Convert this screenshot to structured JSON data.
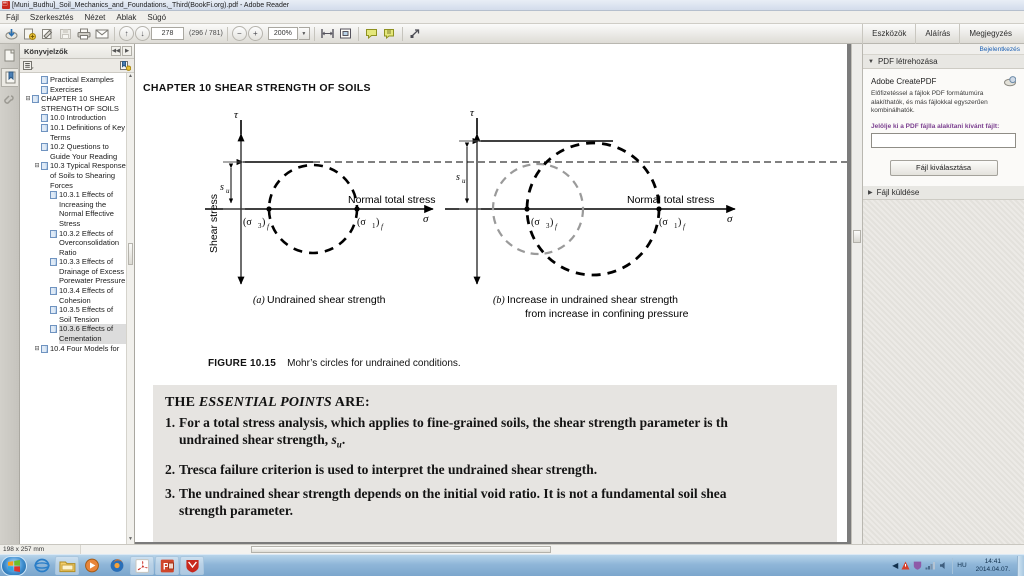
{
  "window": {
    "title": "[Muni_Budhu]_Soil_Mechanics_and_Foundations,_Third(BookFi.org).pdf - Adobe Reader",
    "app_icon": "adobe-reader-icon"
  },
  "menubar": {
    "items": [
      "Fájl",
      "Szerkesztés",
      "Nézet",
      "Ablak",
      "Súgó"
    ]
  },
  "toolbar": {
    "buttons": [
      {
        "name": "save-to-acrobat-com-icon",
        "glyph": "⤓"
      },
      {
        "name": "create-pdf-icon",
        "glyph": "὜E"
      },
      {
        "name": "sign-icon",
        "glyph": "✎"
      },
      {
        "name": "save-icon",
        "glyph": "ὋE"
      },
      {
        "name": "print-icon",
        "glyph": "⎙"
      },
      {
        "name": "email-icon",
        "glyph": "✉"
      }
    ],
    "prev_page_glyph": "↑",
    "next_page_glyph": "↓",
    "page_value": "278",
    "page_count": "(296 / 781)",
    "zoom_out_glyph": "−",
    "zoom_in_glyph": "+",
    "zoom_value": "200%",
    "zoom_dropdown_glyph": "▼",
    "fit_width_glyph": "⌷",
    "fit_page_glyph": "⛶",
    "comment_glyph": "὞9",
    "highlight_glyph": "὘D",
    "fullscreen_glyph": "⤢",
    "right_tabs": [
      "Eszközök",
      "Aláírás",
      "Megjegyzés"
    ]
  },
  "rail": {
    "items": [
      {
        "name": "page-thumbnails-icon",
        "glyph": "❐"
      },
      {
        "name": "bookmarks-icon",
        "glyph": "ὑ6"
      },
      {
        "name": "attachments-icon",
        "glyph": "ὌE"
      }
    ]
  },
  "bookmarks": {
    "panel_title": "Könyvjelzők",
    "nav_prev_glyph": "◀◀",
    "nav_next_glyph": "▶",
    "options_glyph": "≣",
    "newbookmark_glyph": "ὑ6",
    "scroll_up_glyph": "▲",
    "scroll_down_glyph": "▼",
    "items": [
      {
        "label": "Practical Examples",
        "indent": 1,
        "twisty": "",
        "selected": false
      },
      {
        "label": "Exercises",
        "indent": 1,
        "twisty": "",
        "selected": false
      },
      {
        "label": "CHAPTER 10 SHEAR STRENGTH OF SOILS",
        "indent": 0,
        "twisty": "⊟",
        "selected": false
      },
      {
        "label": "10.0 Introduction",
        "indent": 1,
        "twisty": "",
        "selected": false
      },
      {
        "label": "10.1 Definitions of Key Terms",
        "indent": 1,
        "twisty": "",
        "selected": false
      },
      {
        "label": "10.2 Questions to Guide Your Reading",
        "indent": 1,
        "twisty": "",
        "selected": false
      },
      {
        "label": "10.3 Typical Response of Soils to Shearing Forces",
        "indent": 1,
        "twisty": "⊟",
        "selected": false
      },
      {
        "label": "10.3.1 Effects of Increasing the Normal Effective Stress",
        "indent": 2,
        "twisty": "",
        "selected": false
      },
      {
        "label": "10.3.2 Effects of Overconsolidation Ratio",
        "indent": 2,
        "twisty": "",
        "selected": false
      },
      {
        "label": "10.3.3 Effects of Drainage of Excess Porewater Pressure",
        "indent": 2,
        "twisty": "",
        "selected": false
      },
      {
        "label": "10.3.4 Effects of Cohesion",
        "indent": 2,
        "twisty": "",
        "selected": false
      },
      {
        "label": "10.3.5 Effects of Soil Tension",
        "indent": 2,
        "twisty": "",
        "selected": false
      },
      {
        "label": "10.3.6 Effects of Cementation",
        "indent": 2,
        "twisty": "",
        "selected": true
      },
      {
        "label": "10.4 Four Models for",
        "indent": 1,
        "twisty": "⊟",
        "selected": false
      }
    ]
  },
  "document": {
    "chapter_heading": "CHAPTER 10    SHEAR STRENGTH OF SOILS",
    "figure": {
      "panel_a": {
        "tau_label": "τ",
        "sigma_label": "σ",
        "yaxis_label": "Shear stress",
        "xaxis_label": "Normal total stress",
        "su_label": "s",
        "su_sub": "u",
        "sigma3_label": "(σ",
        "sigma3_sub": "3",
        "sigma3_tail": ")",
        "sigma3_f": "f",
        "sigma1_label": "(σ",
        "sigma1_sub": "1",
        "sigma1_tail": ")",
        "sigma1_f": "f",
        "caption": "Undrained shear strength",
        "caption_letter": "a"
      },
      "panel_b": {
        "tau_label": "τ",
        "sigma_label": "σ",
        "xaxis_label": "Normal total stress",
        "su_label": "s",
        "su_sub": "u",
        "sigma3_label": "(σ",
        "sigma3_sub": "3",
        "sigma3_tail": ")",
        "sigma3_f": "f",
        "sigma1_label": "(σ",
        "sigma1_sub": "1",
        "sigma1_tail": ")",
        "sigma1_f": "f",
        "caption_line1": "Increase in undrained shear strength",
        "caption_line2": "from increase in confining pressure",
        "caption_letter": "b"
      },
      "caption_label": "FIGURE 10.15",
      "caption_text": "Mohr’s circles for undrained conditions."
    },
    "essential": {
      "heading_pre": "THE ",
      "heading_italic": "ESSENTIAL POINTS",
      "heading_post": " ARE:",
      "points": [
        {
          "num": "1.",
          "line1": "For a total stress analysis, which applies to fine-grained soils, the shear strength parameter is th",
          "line2_pre": "undrained shear strength, ",
          "line2_sym": "s",
          "line2_sub": "u",
          "line2_post": "."
        },
        {
          "num": "2.",
          "line1": "Tresca failure criterion is used to interpret the undrained shear strength.",
          "line2_pre": "",
          "line2_sym": "",
          "line2_sub": "",
          "line2_post": ""
        },
        {
          "num": "3.",
          "line1": "The undrained shear strength depends on the initial void ratio. It is not a fundamental soil shea",
          "line2_pre": "strength parameter.",
          "line2_sym": "",
          "line2_sub": "",
          "line2_post": ""
        }
      ]
    }
  },
  "rightpanel": {
    "signin": "Bejelentkezés",
    "sections": [
      {
        "caret": "▼",
        "label": "PDF létrehozása"
      },
      {
        "caret": "▶",
        "label": "Fájl küldése"
      }
    ],
    "createpdf_title": "Adobe CreatePDF",
    "createpdf_icon": "createpdf-icon",
    "createpdf_desc": "Előfizetéssel a fájlok PDF formátumúra alakíthatók, és más fájlokkal egyszerűen kombinálhatók.",
    "file_label": "Jelölje ki a PDF fájlla alakítani kívánt fájlt:",
    "file_input_value": "",
    "choose_file_button": "Fájl kiválasztása"
  },
  "statusbar": {
    "dimensions": "198 x 257 mm"
  },
  "taskbar": {
    "start_glyph": "❖",
    "items": [
      {
        "name": "taskbar-internet-explorer-icon",
        "glyph": "℮",
        "color": "#2a7ec8",
        "open": false
      },
      {
        "name": "taskbar-explorer-icon",
        "glyph": "὜1",
        "color": "#d8a33c",
        "open": true
      },
      {
        "name": "taskbar-media-player-icon",
        "glyph": "▶",
        "color": "#e07a28",
        "open": false
      },
      {
        "name": "taskbar-firefox-icon",
        "glyph": "◉",
        "color": "#e06a1b",
        "open": false
      },
      {
        "name": "taskbar-adobe-reader-icon",
        "glyph": "὜B",
        "color": "#c8281e",
        "open": true
      },
      {
        "name": "taskbar-powerpoint-icon",
        "glyph": "P",
        "color": "#c8451e",
        "open": true
      },
      {
        "name": "taskbar-mcafee-icon",
        "glyph": "M",
        "color": "#c8281e",
        "open": true
      }
    ],
    "tray_glyphs": [
      "◀",
      "⚡",
      "Ὦ1",
      "▰",
      "ὐA"
    ],
    "language": "HU",
    "clock_time": "14:41",
    "clock_date": "2014.04.07."
  },
  "colors": {
    "accent_blue": "#1a5fb4",
    "taskbar_blue": "#8fb6d8",
    "label_purple": "#7b3f8f",
    "gray_circle": "#9a9a9a",
    "black": "#000000"
  },
  "chart_data": {
    "type": "scatter",
    "title": "Mohr’s circles for undrained conditions",
    "xlabel": "Normal total stress",
    "ylabel": "Shear stress",
    "panels": [
      {
        "letter": "a",
        "title": "Undrained shear strength",
        "circles": [
          {
            "name": "failure-circle",
            "center_sigma": 1.0,
            "radius": 0.45,
            "style": "dashed",
            "color": "#000000"
          }
        ],
        "annotations": [
          "s_u",
          "(σ3)f",
          "(σ1)f"
        ]
      },
      {
        "letter": "b",
        "title": "Increase in undrained shear strength from increase in confining pressure",
        "circles": [
          {
            "name": "initial-circle",
            "center_sigma": 0.78,
            "radius": 0.45,
            "style": "dashed",
            "color": "#9a9a9a"
          },
          {
            "name": "increased-confining-circle",
            "center_sigma": 1.35,
            "radius": 0.66,
            "style": "dashed",
            "color": "#000000"
          }
        ],
        "annotations": [
          "s_u",
          "(σ3)f",
          "(σ1)f"
        ]
      }
    ]
  }
}
